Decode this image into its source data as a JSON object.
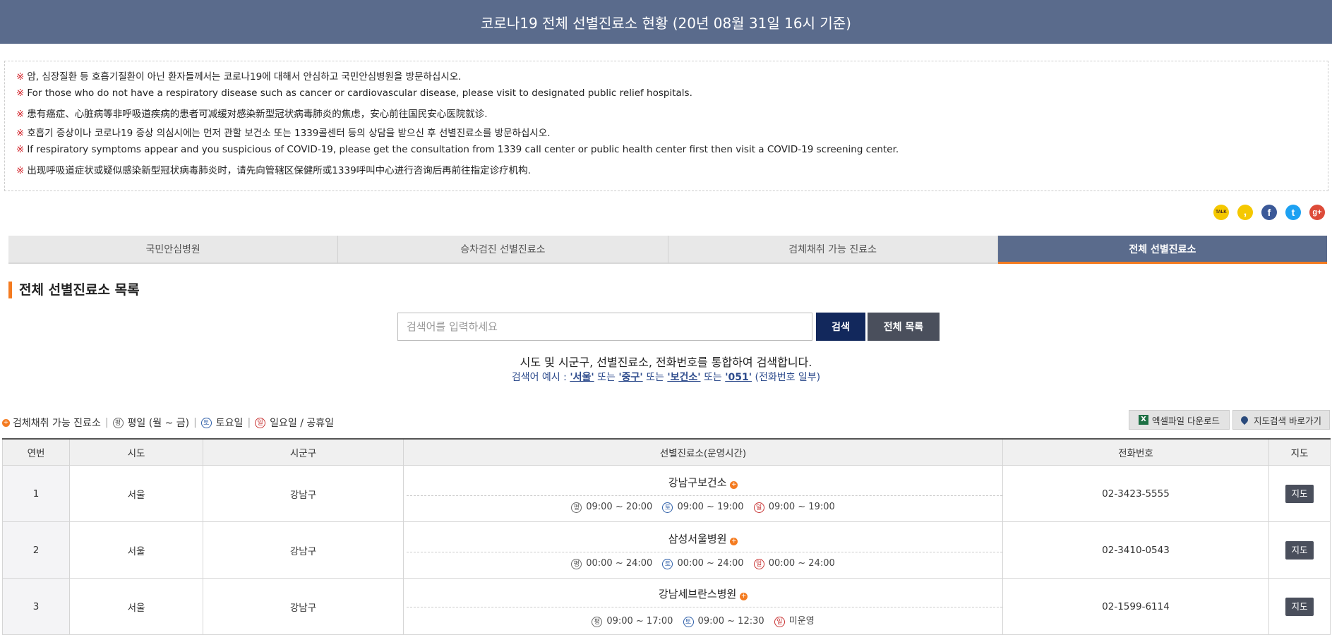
{
  "header": {
    "title": "코로나19 전체 선별진료소 현황 (20년 08월 31일 16시 기준)"
  },
  "notice": {
    "mark": "※",
    "lines": [
      "암, 심장질환 등 호흡기질환이 아닌 환자들께서는 코로나19에 대해서 안심하고 국민안심병원을 방문하십시오.",
      "For those who do not have a respiratory disease such as cancer or cardiovascular disease, please visit to designated public relief hospitals.",
      "患有癌症、心脏病等非呼吸道疾病的患者可减缓对感染新型冠状病毒肺炎的焦虑，安心前往国民安心医院就诊.",
      "호흡기 증상이나 코로나19 증상 의심시에는 먼저 관할 보건소 또는 1339콜센터 등의 상담을 받으신 후 선별진료소를 방문하십시오.",
      "If respiratory symptoms appear and you suspicious of COVID-19, please get the consultation from 1339 call center or public health center first then visit a COVID-19 screening center.",
      "出现呼吸道症状或疑似感染新型冠状病毒肺炎时，请先向管辖区保健所或1339呼叫中心进行咨询后再前往指定诊疗机构."
    ]
  },
  "social": [
    {
      "name": "kakaotalk-icon",
      "label": "TALK",
      "color": "#f5c800",
      "text_color": "#3a1d1d"
    },
    {
      "name": "kakaostory-icon",
      "label": ",",
      "color": "#f5c800",
      "text_color": "#fff"
    },
    {
      "name": "facebook-icon",
      "label": "f",
      "color": "#3b5998",
      "text_color": "#fff"
    },
    {
      "name": "twitter-icon",
      "label": "t",
      "color": "#1da1f2",
      "text_color": "#fff"
    },
    {
      "name": "googleplus-icon",
      "label": "g+",
      "color": "#dd4b39",
      "text_color": "#fff"
    }
  ],
  "tabs": [
    {
      "label": "국민안심병원",
      "active": false
    },
    {
      "label": "승차검진 선별진료소",
      "active": false
    },
    {
      "label": "검체채취 가능 진료소",
      "active": false
    },
    {
      "label": "전체 선별진료소",
      "active": true
    }
  ],
  "section": {
    "title": "전체 선별진료소 목록"
  },
  "search": {
    "placeholder": "검색어를 입력하세요",
    "button": "검색",
    "all_button": "전체 목록",
    "desc": "시도 및 시군구, 선별진료소, 전화번호를 통합하여 검색합니다.",
    "example_prefix": "검색어 예시 : ",
    "examples": [
      "'서울'",
      "'중구'",
      "'보건소'",
      "'051'"
    ],
    "or": "또는",
    "example_suffix": "(전화번호 일부)"
  },
  "legend": {
    "specimen": "검체채취 가능 진료소",
    "weekday_icon": "평",
    "weekday": "평일 (월 ~ 금)",
    "saturday_icon": "토",
    "saturday": "토요일",
    "sunday_icon": "일",
    "sunday": "일요일 / 공휴일"
  },
  "actions": {
    "excel": "엑셀파일 다운로드",
    "map_search": "지도검색 바로가기"
  },
  "table": {
    "headers": [
      "연번",
      "시도",
      "시군구",
      "선별진료소(운영시간)",
      "전화번호",
      "지도"
    ],
    "rows": [
      {
        "no": "1",
        "sido": "서울",
        "sigungu": "강남구",
        "center": "강남구보건소",
        "weekday": "09:00 ~ 20:00",
        "saturday": "09:00 ~ 19:00",
        "sunday": "09:00 ~ 19:00",
        "phone": "02-3423-5555",
        "map": "지도"
      },
      {
        "no": "2",
        "sido": "서울",
        "sigungu": "강남구",
        "center": "삼성서울병원",
        "weekday": "00:00 ~ 24:00",
        "saturday": "00:00 ~ 24:00",
        "sunday": "00:00 ~ 24:00",
        "phone": "02-3410-0543",
        "map": "지도"
      },
      {
        "no": "3",
        "sido": "서울",
        "sigungu": "강남구",
        "center": "강남세브란스병원",
        "weekday": "09:00 ~ 17:00",
        "saturday": "09:00 ~ 12:30",
        "sunday": "미운영",
        "phone": "02-1599-6114",
        "map": "지도"
      }
    ]
  }
}
